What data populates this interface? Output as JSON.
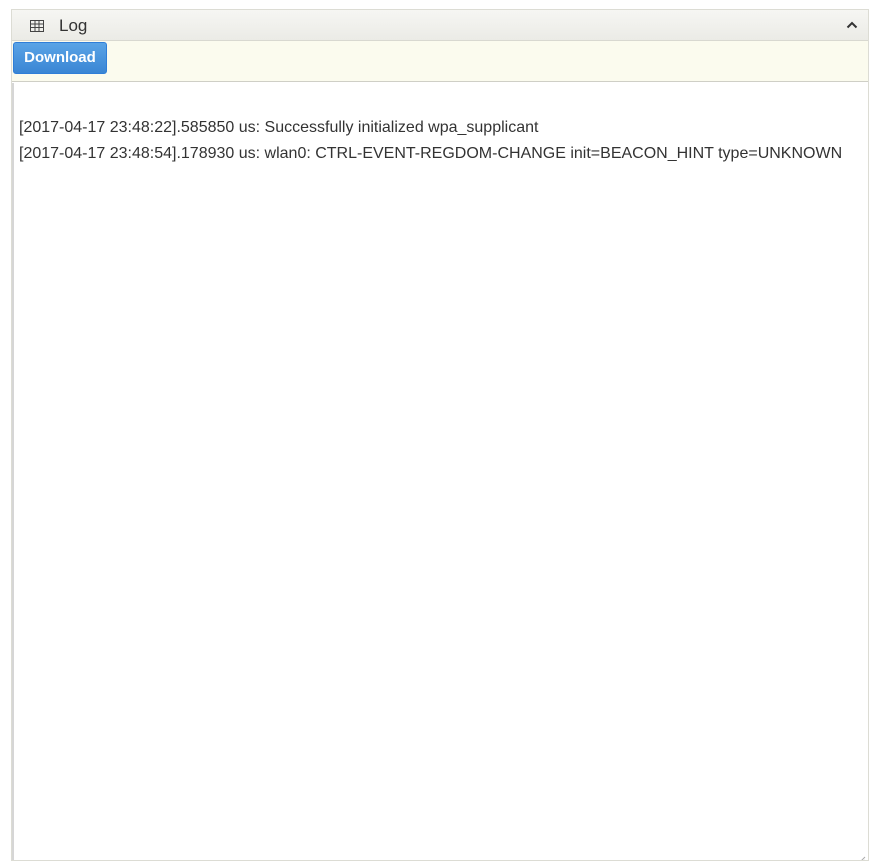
{
  "panel": {
    "title": "Log",
    "icon": "table-icon",
    "collapse_icon": "chevron-up-icon"
  },
  "toolbar": {
    "download_label": "Download"
  },
  "log": {
    "lines": [
      "[2017-04-17 23:48:22].585850 us: Successfully initialized wpa_supplicant",
      "[2017-04-17 23:48:54].178930 us: wlan0: CTRL-EVENT-REGDOM-CHANGE init=BEACON_HINT type=UNKNOWN"
    ]
  },
  "colors": {
    "accent": "#3a86d4",
    "toolbar_bg": "#fbfbee",
    "header_bg": "#efefea",
    "text": "#333333"
  }
}
